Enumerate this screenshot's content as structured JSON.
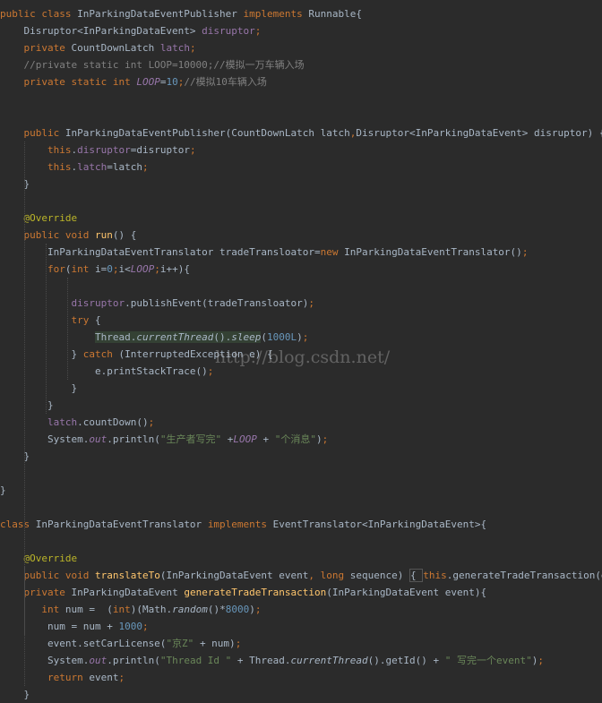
{
  "editor": {
    "lines": [
      [
        [
          "kw",
          "public class "
        ],
        [
          "plain",
          "InParkingDataEventPublisher "
        ],
        [
          "kw",
          "implements "
        ],
        [
          "plain",
          "Runnable{"
        ]
      ],
      [
        [
          "plain",
          "    Disruptor<InParkingDataEvent> "
        ],
        [
          "field",
          "disruptor"
        ],
        [
          "kw",
          ";"
        ]
      ],
      [
        [
          "kw",
          "    private "
        ],
        [
          "plain",
          "CountDownLatch "
        ],
        [
          "field",
          "latch"
        ],
        [
          "kw",
          ";"
        ]
      ],
      [
        [
          "cmt",
          "    //private static int LOOP=10000;//模拟一万车辆入场"
        ]
      ],
      [
        [
          "kw",
          "    private static int "
        ],
        [
          "static",
          "LOOP"
        ],
        [
          "plain",
          "="
        ],
        [
          "num",
          "10"
        ],
        [
          "kw",
          ";"
        ],
        [
          "cmt",
          "//模拟10车辆入场"
        ]
      ],
      [],
      [],
      [
        [
          "kw",
          "    public "
        ],
        [
          "plain",
          "InParkingDataEventPublisher(CountDownLatch latch"
        ],
        [
          "kw",
          ","
        ],
        [
          "plain",
          "Disruptor<InParkingDataEvent> disruptor) {"
        ]
      ],
      [
        [
          "kw",
          "        this"
        ],
        [
          "plain",
          "."
        ],
        [
          "field",
          "disruptor"
        ],
        [
          "plain",
          "=disruptor"
        ],
        [
          "kw",
          ";"
        ]
      ],
      [
        [
          "kw",
          "        this"
        ],
        [
          "plain",
          "."
        ],
        [
          "field",
          "latch"
        ],
        [
          "plain",
          "=latch"
        ],
        [
          "kw",
          ";"
        ]
      ],
      [
        [
          "plain",
          "    }"
        ]
      ],
      [],
      [
        [
          "ann",
          "    @Override"
        ]
      ],
      [
        [
          "kw",
          "    public void "
        ],
        [
          "fn",
          "run"
        ],
        [
          "plain",
          "() {"
        ]
      ],
      [
        [
          "plain",
          "        InParkingDataEventTranslator tradeTransloator="
        ],
        [
          "kw",
          "new "
        ],
        [
          "plain",
          "InParkingDataEventTranslator()"
        ],
        [
          "kw",
          ";"
        ]
      ],
      [
        [
          "kw",
          "        for"
        ],
        [
          "plain",
          "("
        ],
        [
          "kw",
          "int "
        ],
        [
          "plain",
          "i="
        ],
        [
          "num",
          "0"
        ],
        [
          "kw",
          ";"
        ],
        [
          "plain",
          "i<"
        ],
        [
          "static",
          "LOOP"
        ],
        [
          "kw",
          ";"
        ],
        [
          "plain",
          "i++){"
        ]
      ],
      [],
      [
        [
          "plain",
          "            "
        ],
        [
          "field",
          "disruptor"
        ],
        [
          "plain",
          ".publishEvent(tradeTransloator)"
        ],
        [
          "kw",
          ";"
        ]
      ],
      [
        [
          "kw",
          "            try "
        ],
        [
          "plain",
          "{"
        ]
      ],
      [
        [
          "plain",
          "                "
        ],
        [
          "hl",
          "Thread."
        ],
        [
          "hlstatic",
          "currentThread"
        ],
        [
          "hl",
          "()."
        ],
        [
          "hlstatic",
          "sleep"
        ],
        [
          "plain",
          "("
        ],
        [
          "num",
          "1000L"
        ],
        [
          "plain",
          ")"
        ],
        [
          "kw",
          ";"
        ]
      ],
      [
        [
          "plain",
          "            } "
        ],
        [
          "kw",
          "catch "
        ],
        [
          "plain",
          "(InterruptedException e) {"
        ]
      ],
      [
        [
          "plain",
          "                e.printStackTrace()"
        ],
        [
          "kw",
          ";"
        ]
      ],
      [
        [
          "plain",
          "            }"
        ]
      ],
      [
        [
          "plain",
          "        }"
        ]
      ],
      [
        [
          "plain",
          "        "
        ],
        [
          "field",
          "latch"
        ],
        [
          "plain",
          ".countDown()"
        ],
        [
          "kw",
          ";"
        ]
      ],
      [
        [
          "plain",
          "        System."
        ],
        [
          "static",
          "out"
        ],
        [
          "plain",
          ".println("
        ],
        [
          "str",
          "\"生产者写完\" "
        ],
        [
          "plain",
          "+"
        ],
        [
          "static",
          "LOOP "
        ],
        [
          "plain",
          "+ "
        ],
        [
          "str",
          "\"个消息\""
        ],
        [
          "plain",
          ")"
        ],
        [
          "kw",
          ";"
        ]
      ],
      [
        [
          "plain",
          "    }"
        ]
      ],
      [],
      [
        [
          "plain",
          "}"
        ]
      ],
      [],
      [
        [
          "kw",
          "class "
        ],
        [
          "plain",
          "InParkingDataEventTranslator "
        ],
        [
          "kw",
          "implements "
        ],
        [
          "plain",
          "EventTranslator<InParkingDataEvent>{"
        ]
      ],
      [],
      [
        [
          "ann",
          "    @Override"
        ]
      ],
      [
        [
          "kw",
          "    public void "
        ],
        [
          "fn",
          "translateTo"
        ],
        [
          "plain",
          "(InParkingDataEvent event"
        ],
        [
          "kw",
          ", long "
        ],
        [
          "plain",
          "sequence) "
        ],
        [
          "fold",
          "{ "
        ],
        [
          "kw",
          "this"
        ],
        [
          "plain",
          ".generateTradeTransaction(event)"
        ],
        [
          "kw",
          "; "
        ],
        [
          "fold",
          "}"
        ]
      ],
      [
        [
          "kw",
          "    private "
        ],
        [
          "plain",
          "InParkingDataEvent "
        ],
        [
          "fn",
          "generateTradeTransaction"
        ],
        [
          "plain",
          "(InParkingDataEvent event){"
        ]
      ],
      [
        [
          "kw",
          "       int "
        ],
        [
          "plain",
          "num =  ("
        ],
        [
          "kw",
          "int"
        ],
        [
          "plain",
          ")(Math."
        ],
        [
          "staticm",
          "random"
        ],
        [
          "plain",
          "()*"
        ],
        [
          "num",
          "8000"
        ],
        [
          "plain",
          ")"
        ],
        [
          "kw",
          ";"
        ]
      ],
      [
        [
          "plain",
          "        num = num + "
        ],
        [
          "num",
          "1000"
        ],
        [
          "kw",
          ";"
        ]
      ],
      [
        [
          "plain",
          "        event.setCarLicense("
        ],
        [
          "str",
          "\"京Z\" "
        ],
        [
          "plain",
          "+ num)"
        ],
        [
          "kw",
          ";"
        ]
      ],
      [
        [
          "plain",
          "        System."
        ],
        [
          "static",
          "out"
        ],
        [
          "plain",
          ".println("
        ],
        [
          "str",
          "\"Thread Id \" "
        ],
        [
          "plain",
          "+ Thread."
        ],
        [
          "staticm",
          "currentThread"
        ],
        [
          "plain",
          "().getId() + "
        ],
        [
          "str",
          "\" 写完一个event\""
        ],
        [
          "plain",
          ")"
        ],
        [
          "kw",
          ";"
        ]
      ],
      [
        [
          "kw",
          "        return "
        ],
        [
          "plain",
          "event"
        ],
        [
          "kw",
          ";"
        ]
      ],
      [
        [
          "plain",
          "    }"
        ]
      ]
    ]
  },
  "watermark": "http://blog.csdn.net/"
}
